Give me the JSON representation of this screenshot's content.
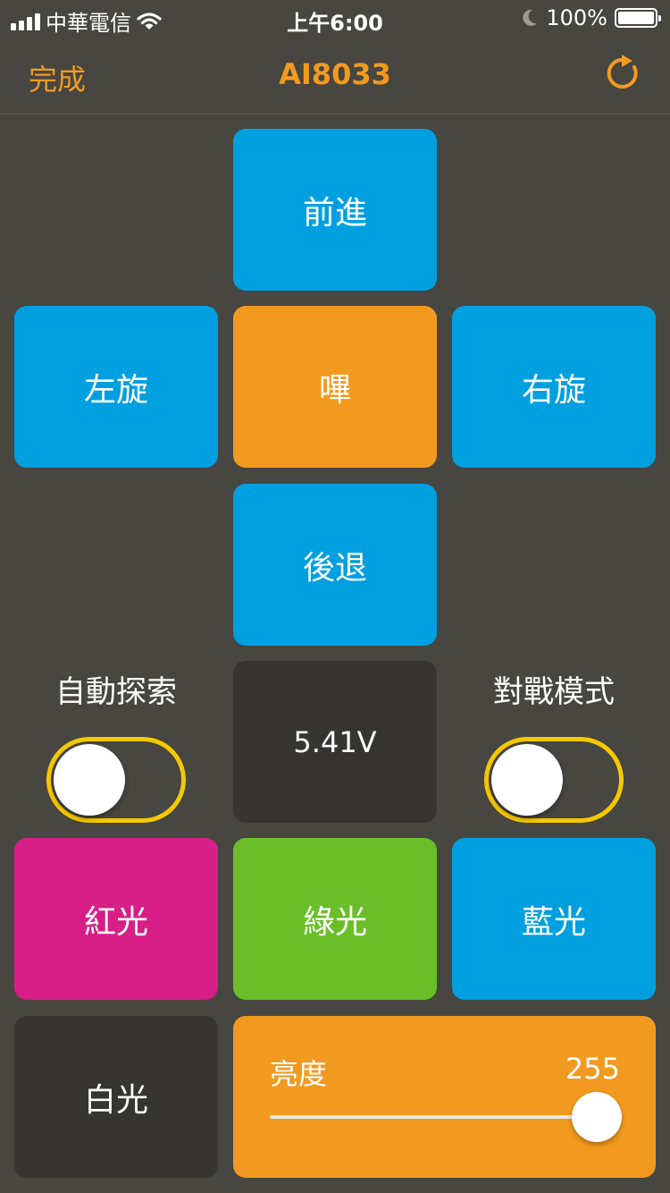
{
  "status_bar": {
    "carrier": "中華電信",
    "time": "上午6:00",
    "battery": "100%"
  },
  "nav": {
    "done_label": "完成",
    "title": "AI8033",
    "refresh_icon": "refresh-icon"
  },
  "controls": {
    "forward": "前進",
    "rotate_left": "左旋",
    "beep": "嗶",
    "rotate_right": "右旋",
    "backward": "後退",
    "auto_explore_label": "自動探索",
    "auto_explore_on": false,
    "voltage": "5.41V",
    "battle_mode_label": "對戰模式",
    "battle_mode_on": false,
    "red_light": "紅光",
    "green_light": "綠光",
    "blue_light": "藍光",
    "white_light": "白光",
    "brightness_label": "亮度",
    "brightness_value": "255",
    "brightness_fraction": 1.0
  },
  "colors": {
    "accent": "#f29a1f",
    "blue": "#00a0e0",
    "pink": "#d81f87",
    "green": "#6abf28",
    "dark_tile": "#363531",
    "background": "#474641",
    "toggle_border": "#f5c800"
  }
}
